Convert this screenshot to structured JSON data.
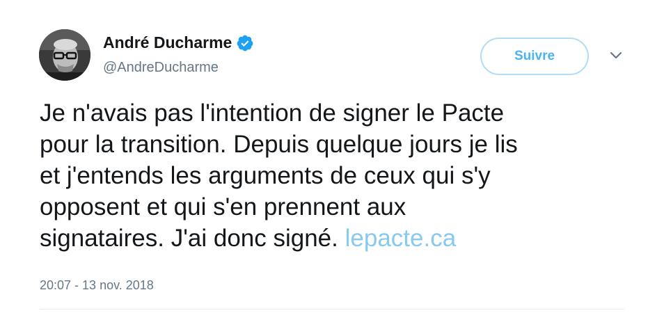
{
  "author": {
    "display_name": "André Ducharme",
    "handle": "@AndreDucharme",
    "verified": true
  },
  "follow_button": {
    "label": "Suivre"
  },
  "menu": {
    "icon": "chevron-down-icon"
  },
  "tweet": {
    "lines": [
      "Je n'avais pas l'intention de signer le Pacte",
      "pour la transition. Depuis quelque jours je lis",
      "et j'entends les arguments de ceux qui s'y",
      "opposent et qui s'en prennent aux",
      "signataires. J'ai donc signé."
    ],
    "link_text": "lepacte.ca",
    "timestamp": "20:07 - 13 nov. 2018"
  },
  "colors": {
    "link": "#88c9f0",
    "follow_border": "#b3dcf6",
    "follow_text": "#4ab3f4",
    "verified_badge": "#1da1f2",
    "secondary_text": "#657786"
  }
}
